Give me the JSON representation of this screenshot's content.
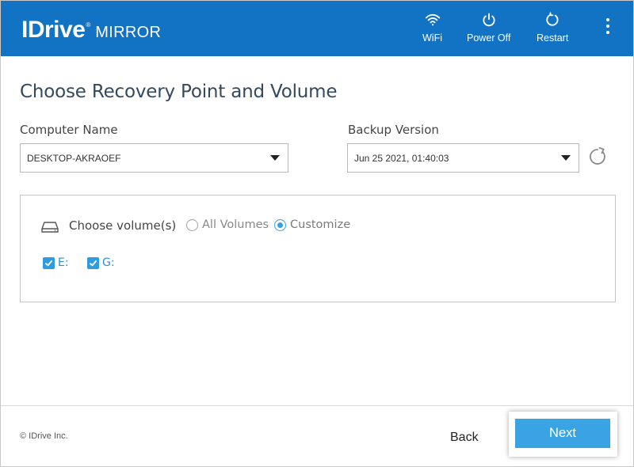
{
  "header": {
    "brand": "IDrive",
    "registered_mark": "®",
    "product": "MIRROR",
    "buttons": {
      "wifi": "WiFi",
      "power_off": "Power Off",
      "restart": "Restart"
    },
    "icons": [
      "wifi-icon",
      "power-icon",
      "restart-icon",
      "more-vertical-icon"
    ]
  },
  "main": {
    "title": "Choose Recovery Point and Volume",
    "computer_name": {
      "label": "Computer Name",
      "value": "DESKTOP-AKRAOEF"
    },
    "backup_version": {
      "label": "Backup Version",
      "value": "Jun 25 2021, 01:40:03"
    },
    "volumes": {
      "label": "Choose volume(s)",
      "options": {
        "all": "All Volumes",
        "customize": "Customize"
      },
      "selected_option": "Customize",
      "drives": [
        {
          "label": "E:",
          "checked": true
        },
        {
          "label": "G:",
          "checked": true
        }
      ]
    }
  },
  "footer": {
    "copyright": "© IDrive Inc.",
    "back_label": "Back",
    "next_label": "Next"
  },
  "colors": {
    "header_bg": "#1273c4",
    "accent": "#3aa3e3",
    "checkbox": "#2f9be0"
  }
}
